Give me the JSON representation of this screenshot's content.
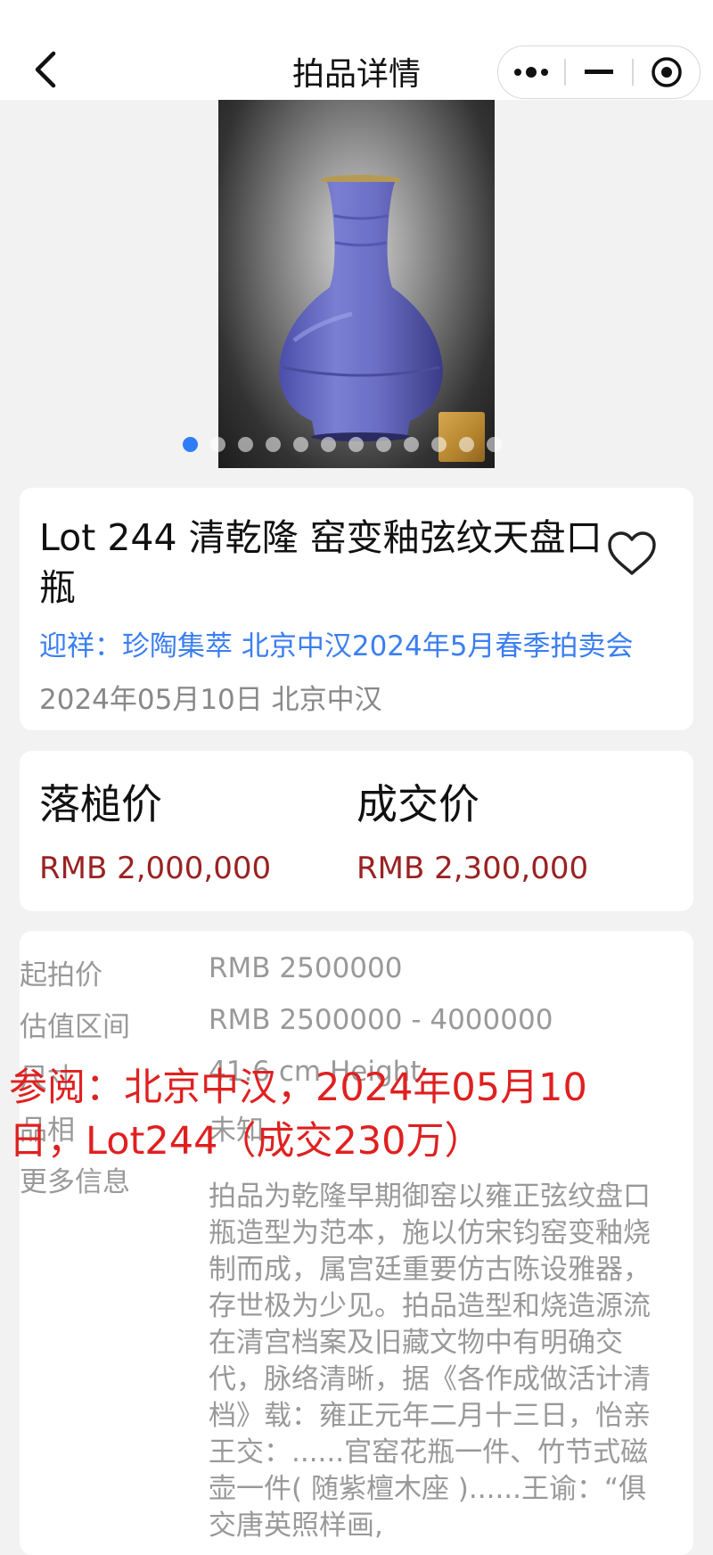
{
  "nav": {
    "title": "拍品详情"
  },
  "hero": {
    "slide_count": 12,
    "active_slide": 0
  },
  "lot": {
    "title": "Lot 244 清乾隆 窑变釉弦纹天盘口瓶",
    "sale_link": "迎祥：珍陶集萃 北京中汉2024年5月春季拍卖会",
    "meta": "2024年05月10日 北京中汉"
  },
  "prices": {
    "hammer_label": "落槌价",
    "hammer_value": "RMB 2,000,000",
    "final_label": "成交价",
    "final_value": "RMB 2,300,000"
  },
  "details": {
    "start_label": "起拍价",
    "start_value": "RMB 2500000",
    "estimate_label": "估值区间",
    "estimate_value": "RMB 2500000 - 4000000",
    "size_label": "尺寸",
    "size_value": "41.6 cm Height",
    "condition_label": "品相",
    "condition_value": "未知",
    "more_label": "更多信息",
    "more_value": "拍品为乾隆早期御窑以雍正弦纹盘口瓶造型为范本，施以仿宋钧窑变釉烧制而成，属宫廷重要仿古陈设雅器，存世极为少见。拍品造型和烧造源流在清宫档案及旧藏文物中有明确交代，脉络清晰，据《各作成做活计清档》载：雍正元年二月十三日，怡亲王交：......官窑花瓶一件、竹节式磁壶一件( 随紫檀木座 )......王谕：“俱交唐英照样画,"
  },
  "overlay": {
    "text": "参阅：北京中汉，2024年05月10日，Lot244（成交230万）"
  },
  "colors": {
    "accent_blue": "#3b7ef0",
    "price_red": "#9a2222",
    "overlay_red": "#e02020",
    "dot_active": "#2f7df6"
  }
}
